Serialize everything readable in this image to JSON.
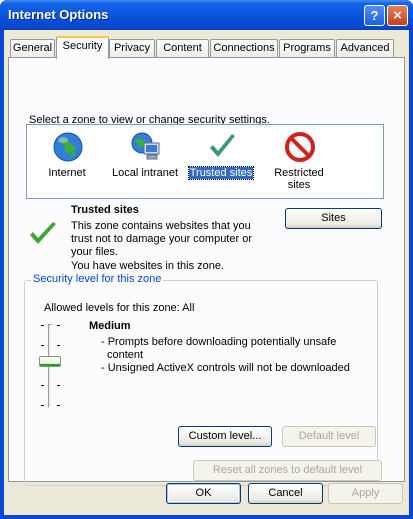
{
  "window": {
    "title": "Internet Options"
  },
  "tabs": [
    "General",
    "Security",
    "Privacy",
    "Content",
    "Connections",
    "Programs",
    "Advanced"
  ],
  "security": {
    "instruction": "Select a zone to view or change security settings.",
    "zones": [
      {
        "name": "Internet",
        "icon": "globe-icon"
      },
      {
        "name": "Local intranet",
        "icon": "network-computer-icon"
      },
      {
        "name": "Trusted sites",
        "icon": "checkmark-icon",
        "selected": true
      },
      {
        "name": "Restricted\nsites",
        "icon": "no-entry-icon"
      }
    ],
    "zone_heading": "Trusted sites",
    "zone_description": [
      "This zone contains websites that you",
      "trust not to damage your computer or",
      "your files.",
      "You have websites in this zone."
    ],
    "sites_button": "Sites",
    "group_title": "Security level for this zone",
    "allowed_levels": "Allowed levels for this zone: All",
    "level_name": "Medium",
    "level_details": [
      "- Prompts before downloading potentially unsafe",
      "content",
      "- Unsigned ActiveX controls will not be downloaded"
    ],
    "custom_level_button": "Custom level...",
    "default_level_button": "Default level",
    "reset_button": "Reset all zones to default level",
    "slider_level": "3 of 5"
  },
  "footer": {
    "ok": "OK",
    "cancel": "Cancel",
    "apply": "Apply"
  },
  "colors": {
    "title_bar": "#0a55dc",
    "dialog_bg": "#ece9d8",
    "group_title": "#0046d5",
    "selection": "#316ac5"
  }
}
